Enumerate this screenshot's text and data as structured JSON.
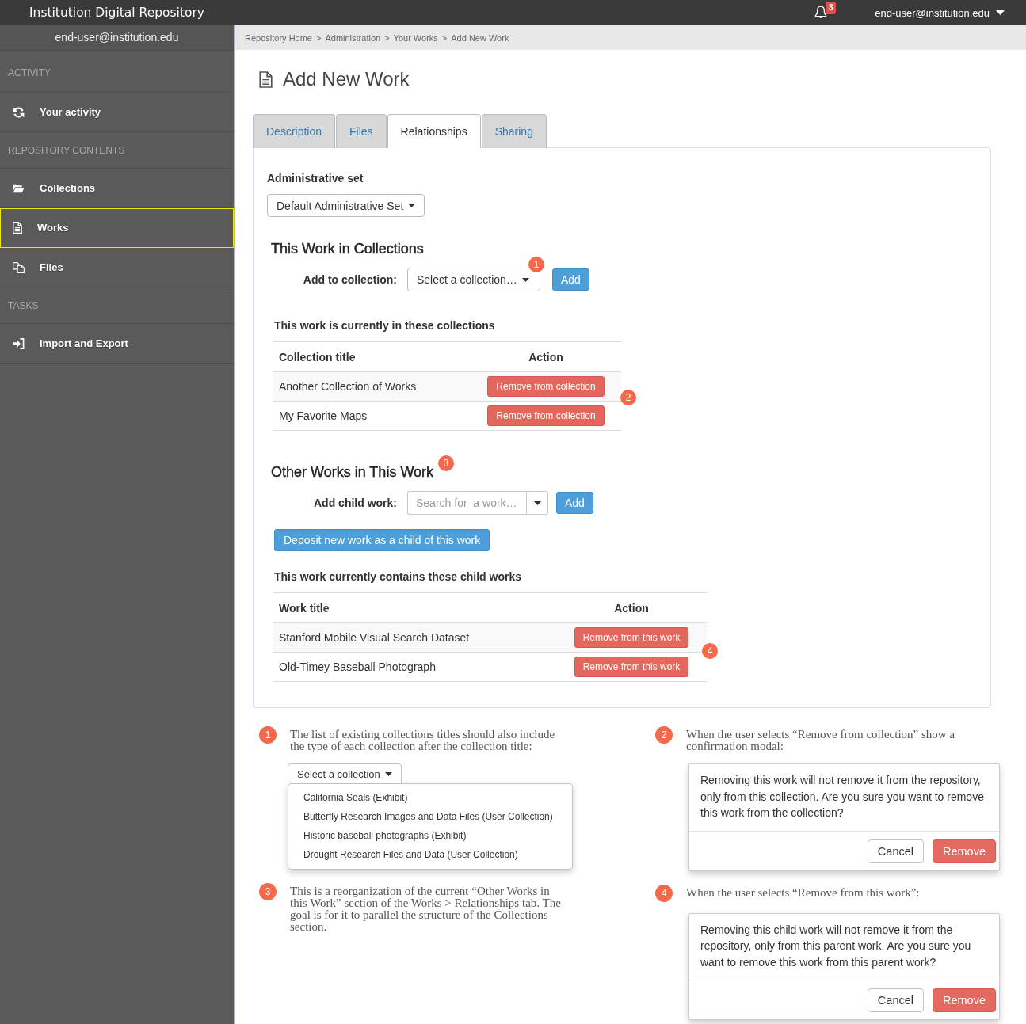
{
  "top_bar": {
    "title": "Institution Digital Repository",
    "notification_count": "3",
    "user": "end-user@institution.edu"
  },
  "sidebar": {
    "user": "end-user@institution.edu",
    "sections": [
      {
        "heading": "ACTIVITY",
        "items": [
          {
            "kind": "activity",
            "label": "Your activity",
            "selected": false
          }
        ]
      },
      {
        "heading": "REPOSITORY CONTENTS",
        "items": [
          {
            "kind": "collections",
            "label": "Collections",
            "selected": false
          },
          {
            "kind": "works",
            "label": "Works",
            "selected": true
          },
          {
            "kind": "files",
            "label": "Files",
            "selected": false
          }
        ]
      },
      {
        "heading": "TASKS",
        "items": [
          {
            "kind": "transfer",
            "label": "Import and Export",
            "selected": false
          }
        ]
      }
    ]
  },
  "breadcrumb": [
    {
      "label": "Repository Home",
      "separator": ">"
    },
    {
      "label": "Administration",
      "separator": ">"
    },
    {
      "label": "Your Works",
      "separator": ">"
    },
    {
      "label": "Add New Work"
    }
  ],
  "page": {
    "title": "Add New Work"
  },
  "tabs": [
    {
      "label": "Description",
      "selected": false
    },
    {
      "label": "Files",
      "selected": false
    },
    {
      "label": "Relationships",
      "selected": true
    },
    {
      "label": "Sharing",
      "selected": false
    }
  ],
  "relationships": {
    "admin_set": {
      "label": "Administrative set",
      "value": "Default Administrative Set"
    },
    "collections": {
      "heading": "This Work in Collections",
      "add_label": "Add to collection:",
      "select": "Select a collection…",
      "select_marker": "1",
      "add_button": "Add",
      "list_heading": "This work is currently in these collections",
      "columns": [
        "Collection title",
        "Action"
      ],
      "rows": [
        {
          "title": "Another Collection of Works",
          "action": "Remove from collection"
        },
        {
          "title": "My Favorite Maps",
          "action": "Remove from collection"
        }
      ],
      "table_marker": "2"
    },
    "child_works": {
      "heading": "Other Works in This Work",
      "heading_marker": "3",
      "add_label": "Add child work:",
      "placeholder": "Search for  a work…",
      "add_button": "Add",
      "deposit_button": "Deposit new work as a child of this work",
      "list_heading": "This work currently contains these child works",
      "columns": [
        "Work title",
        "Action"
      ],
      "rows": [
        {
          "title": "Stanford Mobile Visual Search Dataset",
          "action": "Remove from this work"
        },
        {
          "title": "Old-Timey Baseball Photograph",
          "action": "Remove from this work"
        }
      ],
      "table_marker": "4"
    }
  },
  "note_columns": [
    [
      {
        "kind": "dropdown",
        "marker": "1",
        "text": "The list of existing collections titles should also include the type of each collection after the collection title:",
        "dropdown": {
          "label": "Select a collection",
          "options": [
            "California Seals (Exhibit)",
            "Butterfly Research Images and Data Files (User Collection)",
            "Historic baseball photographs (Exhibit)",
            "Drought Research Files and Data (User Collection)"
          ]
        }
      },
      {
        "kind": "text",
        "marker": "3",
        "text": "This is a reorganization of the current “Other Works in this Work” section of the Works > Relationships tab. The goal is for it to parallel the structure of the Collections section."
      }
    ],
    [
      {
        "kind": "modal",
        "marker": "2",
        "text": "When the user selects “Remove from collection” show a confirmation modal:",
        "modal": {
          "message": "Removing this work will not remove it from the repository, only from this collection. Are you sure you want to remove this work from the collection?",
          "buttons": [
            {
              "label": "Cancel",
              "kind": "default"
            },
            {
              "label": "Remove",
              "kind": "danger"
            }
          ]
        }
      },
      {
        "kind": "modal",
        "marker": "4",
        "text": "When the user selects “Remove from this work”:",
        "modal": {
          "message": "Removing this child work will not remove it from the repository, only from this parent work. Are you sure you want to remove this work from this parent work?",
          "buttons": [
            {
              "label": "Cancel",
              "kind": "default"
            },
            {
              "label": "Remove",
              "kind": "danger"
            }
          ]
        }
      }
    ]
  ]
}
